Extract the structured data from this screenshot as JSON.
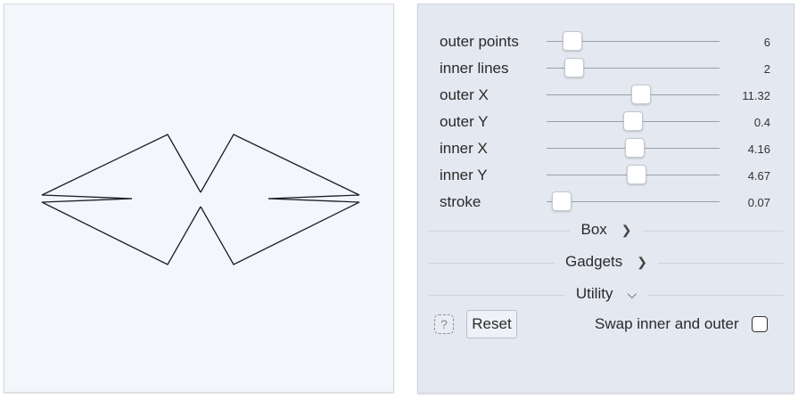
{
  "sliders": [
    {
      "label": "outer points",
      "value": "6",
      "level": 0.15
    },
    {
      "label": "inner lines",
      "value": "2",
      "level": 0.16
    },
    {
      "label": "outer X",
      "value": "11.32",
      "level": 0.55
    },
    {
      "label": "outer Y",
      "value": "0.4",
      "level": 0.5
    },
    {
      "label": "inner X",
      "value": "4.16",
      "level": 0.51
    },
    {
      "label": "inner Y",
      "value": "4.67",
      "level": 0.52
    },
    {
      "label": "stroke",
      "value": "0.07",
      "level": 0.09
    }
  ],
  "sections": {
    "box": "Box",
    "gadgets": "Gadgets",
    "utility": "Utility"
  },
  "buttons": {
    "help": "?",
    "reset": "Reset"
  },
  "swap": {
    "label": "Swap inner and outer",
    "checked": false
  },
  "colors": {
    "canvas_bg": "#f3f6fa",
    "stroke": "#1a1d26",
    "panel_bg": "#e4e8f0"
  }
}
